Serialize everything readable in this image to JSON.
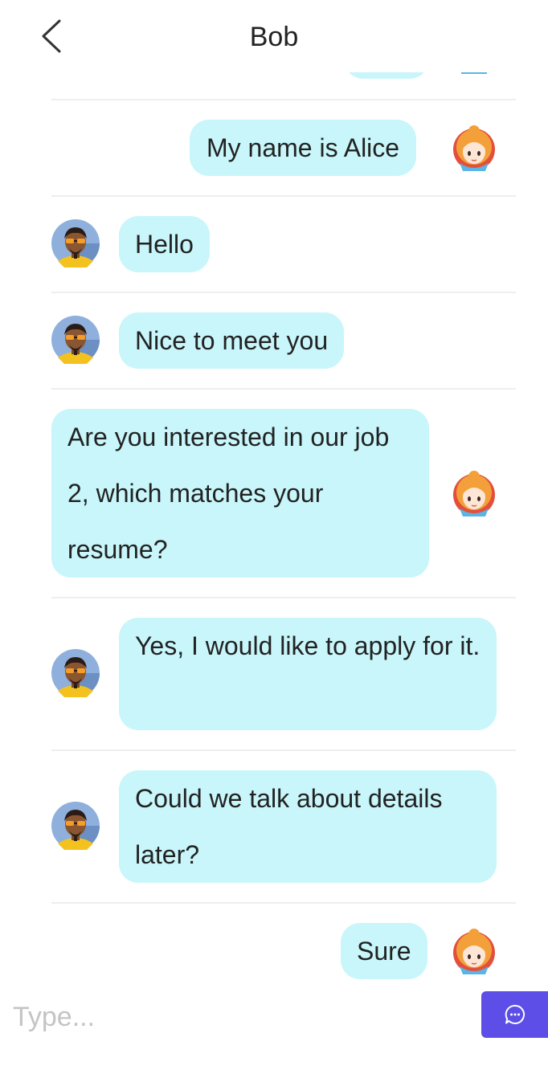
{
  "header": {
    "title": "Bob",
    "back_icon": "chevron-left-icon"
  },
  "messages": [
    {
      "sender": "Alice",
      "side": "right",
      "text": ""
    },
    {
      "sender": "Alice",
      "side": "right",
      "text": "My name is Alice"
    },
    {
      "sender": "Bob",
      "side": "left",
      "text": "Hello"
    },
    {
      "sender": "Bob",
      "side": "left",
      "text": "Nice to meet you"
    },
    {
      "sender": "Alice",
      "side": "right",
      "text": "Are you interested in our job 2, which matches your resume?"
    },
    {
      "sender": "Bob",
      "side": "left",
      "text": "Yes, I would like to apply for it."
    },
    {
      "sender": "Bob",
      "side": "left",
      "text": "Could we talk about details later?"
    },
    {
      "sender": "Alice",
      "side": "right",
      "text": "Sure"
    }
  ],
  "composer": {
    "placeholder": "Type...",
    "value": "",
    "send_icon": "chat-bubble-icon"
  },
  "colors": {
    "bubble": "#c8f6fa",
    "send_button": "#5c4ee6",
    "separator": "#eeeeee",
    "placeholder": "#c4c4c4"
  }
}
